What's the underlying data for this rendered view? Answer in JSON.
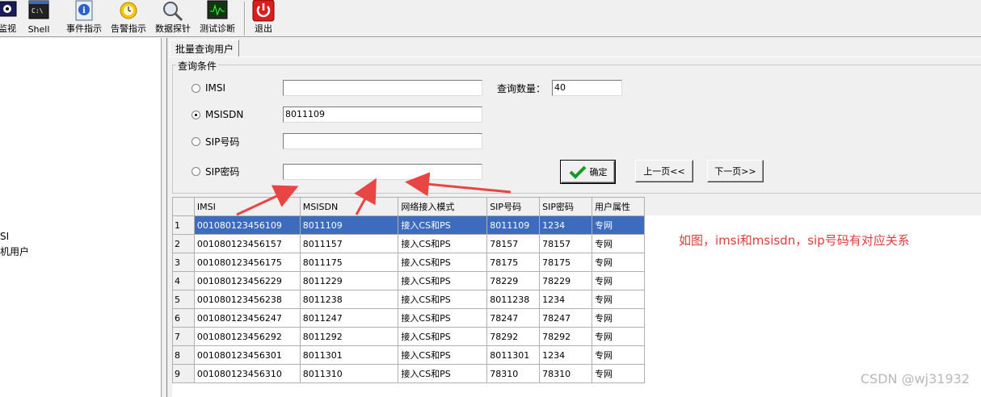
{
  "toolbar": {
    "buttons": [
      {
        "label": "监视",
        "icon": "monitor-icon"
      },
      {
        "label": "Shell",
        "icon": "shell-icon"
      },
      {
        "label": "事件指示",
        "icon": "info-icon"
      },
      {
        "label": "告警指示",
        "icon": "alarm-clock-icon"
      },
      {
        "label": "数据探针",
        "icon": "magnifier-icon"
      },
      {
        "label": "测试诊断",
        "icon": "oscilloscope-icon"
      },
      {
        "label": "退出",
        "icon": "power-icon"
      }
    ]
  },
  "tree": {
    "nodes": [
      "SI",
      "机用户"
    ]
  },
  "tab": {
    "label": "批量查询用户"
  },
  "query": {
    "group_title": "查询条件",
    "options": [
      {
        "label": "IMSI",
        "value": "",
        "checked": false
      },
      {
        "label": "MSISDN",
        "value": "8011109",
        "checked": true
      },
      {
        "label": "SIP号码",
        "value": "",
        "checked": false
      },
      {
        "label": "SIP密码",
        "value": "",
        "checked": false
      }
    ],
    "count_label": "查询数量：",
    "count_value": "40",
    "confirm_label": "确定",
    "prev_label": "上一页<<",
    "next_label": "下一页>>"
  },
  "grid": {
    "columns": [
      "IMSI",
      "MSISDN",
      "网络接入模式",
      "SIP号码",
      "SIP密码",
      "用户属性"
    ],
    "rows": [
      [
        "1",
        "001080123456109",
        "8011109",
        "接入CS和PS",
        "8011109",
        "1234",
        "专网"
      ],
      [
        "2",
        "001080123456157",
        "8011157",
        "接入CS和PS",
        "78157",
        "78157",
        "专网"
      ],
      [
        "3",
        "001080123456175",
        "8011175",
        "接入CS和PS",
        "78175",
        "78175",
        "专网"
      ],
      [
        "4",
        "001080123456229",
        "8011229",
        "接入CS和PS",
        "78229",
        "78229",
        "专网"
      ],
      [
        "5",
        "001080123456238",
        "8011238",
        "接入CS和PS",
        "8011238",
        "1234",
        "专网"
      ],
      [
        "6",
        "001080123456247",
        "8011247",
        "接入CS和PS",
        "78247",
        "78247",
        "专网"
      ],
      [
        "7",
        "001080123456292",
        "8011292",
        "接入CS和PS",
        "78292",
        "78292",
        "专网"
      ],
      [
        "8",
        "001080123456301",
        "8011301",
        "接入CS和PS",
        "8011301",
        "1234",
        "专网"
      ],
      [
        "9",
        "001080123456310",
        "8011310",
        "接入CS和PS",
        "78310",
        "78310",
        "专网"
      ]
    ],
    "selected_row": 0
  },
  "annotation": "如图，imsi和msisdn，sip号码有对应关系",
  "watermark": "CSDN @wj31932",
  "colors": {
    "selection": "#3d6bbd",
    "annotation": "#e03c3c",
    "arrow": "#e84545"
  }
}
